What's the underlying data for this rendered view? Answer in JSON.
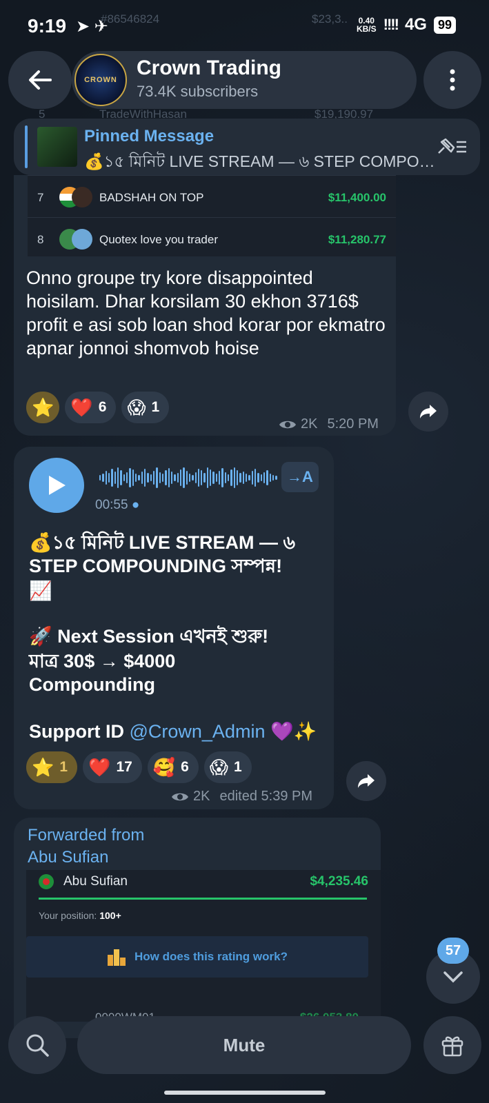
{
  "status_bar": {
    "time": "9:19",
    "icons": "➤ ✈",
    "net_speed_top": "0.40",
    "net_speed_bottom": "KB/S",
    "signal": "!!!!",
    "network": "4G",
    "battery": "99"
  },
  "header": {
    "title": "Crown Trading",
    "subtitle": "73.4K subscribers",
    "avatar_text": "CROWN"
  },
  "pinned": {
    "title": "Pinned Message",
    "text": "💰১৫ মিনিট LIVE STREAM — ৬ STEP COMPOUNDING সম্পন্ন!"
  },
  "background_ghost": {
    "row_top_id": "#86546824",
    "row_top_val": "$23,3..",
    "row_5_rank": "5",
    "row_5_name": "TradeWithHasan",
    "row_5_val": "$19,190.97"
  },
  "message1": {
    "leaderboard": [
      {
        "rank": "7",
        "name": "BADSHAH ON TOP",
        "value": "$11,400.00"
      },
      {
        "rank": "8",
        "name": "Quotex love you trader",
        "value": "$11,280.77"
      }
    ],
    "text": "Onno groupe try kore disappointed hoisilam. Dhar korsilam 30 ekhon 3716$ profit e asi sob loan shod korar por ekmatro apnar jonnoi shomvob hoise",
    "reactions": [
      {
        "emoji": "⭐",
        "count": ""
      },
      {
        "emoji": "❤️",
        "count": "6"
      },
      {
        "emoji": "😱",
        "count": "1"
      }
    ],
    "views": "2K",
    "time": "5:20 PM"
  },
  "message2": {
    "audio_duration": "00:55",
    "transcribe_label": "→A",
    "line1": "💰১৫ মিনিট LIVE STREAM — ৬",
    "line2": "STEP COMPOUNDING সম্পন্ন!",
    "line3": "📈",
    "line4": "🚀 Next Session এখনই শুরু!",
    "line5": "মাত্র 30$ → $4000",
    "line6": "Compounding",
    "support_prefix": "Support ID ",
    "support_link": "@Crown_Admin",
    "support_suffix": " 💜✨",
    "reactions": [
      {
        "emoji": "⭐",
        "count": "1"
      },
      {
        "emoji": "❤️",
        "count": "17"
      },
      {
        "emoji": "🥰",
        "count": "6"
      },
      {
        "emoji": "😱",
        "count": "1"
      }
    ],
    "views": "2K",
    "time": "edited 5:39 PM"
  },
  "message3": {
    "forwarded_label": "Forwarded from",
    "forwarded_from": "Abu Sufian",
    "board_name": "Abu Sufian",
    "board_value": "$4,235.46",
    "position_label": "Your position:",
    "position_value": "100+",
    "rating_link": "How does this rating work?",
    "next_row_name": "0000WM01",
    "next_row_value": "$26,053.80"
  },
  "bottom": {
    "unread_count": "57",
    "mute_label": "Mute"
  },
  "colors": {
    "accent": "#5fa8e8",
    "bubble": "#212b37",
    "profit_green": "#27c46a"
  }
}
